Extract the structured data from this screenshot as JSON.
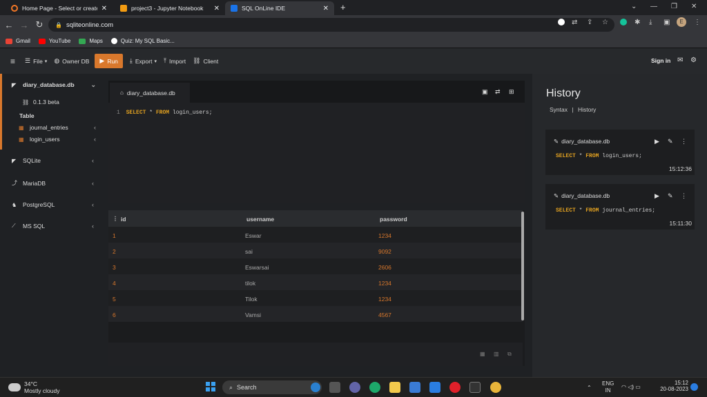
{
  "browser": {
    "tabs": [
      {
        "title": "Home Page - Select or create a n",
        "color": "#f37726"
      },
      {
        "title": "project3 - Jupyter Notebook",
        "color": "#f39c12"
      },
      {
        "title": "SQL OnLine IDE",
        "color": "#1a73e8"
      }
    ],
    "url": "sqliteonline.com",
    "bookmarks": [
      {
        "label": "Gmail",
        "color": "#ea4335"
      },
      {
        "label": "YouTube",
        "color": "#ff0000"
      },
      {
        "label": "Maps",
        "color": "#34a853"
      },
      {
        "label": "Quiz: My SQL Basic...",
        "color": "#ffffff"
      }
    ],
    "profile_initial": "E"
  },
  "toolbar": {
    "file": "File",
    "owner_db": "Owner DB",
    "run": "Run",
    "export": "Export",
    "import": "Import",
    "client": "Client",
    "signin": "Sign in"
  },
  "sidebar": {
    "db_name": "diary_database.db",
    "version": "0.1.3 beta",
    "table_heading": "Table",
    "tables": [
      "journal_entries",
      "login_users"
    ],
    "engines": [
      "SQLite",
      "MariaDB",
      "PostgreSQL",
      "MS SQL"
    ]
  },
  "editor": {
    "tab": "diary_database.db",
    "line_number": "1",
    "kw1": "SELECT",
    "star": "*",
    "kw2": "FROM",
    "table": "login_users;"
  },
  "results": {
    "columns": [
      "id",
      "username",
      "password"
    ],
    "rows": [
      [
        "1",
        "Eswar",
        "1234"
      ],
      [
        "2",
        "sai",
        "9092"
      ],
      [
        "3",
        "Eswarsai",
        "2606"
      ],
      [
        "4",
        "tilok",
        "1234"
      ],
      [
        "5",
        "Tilok",
        "1234"
      ],
      [
        "6",
        "Vamsi",
        "4567"
      ]
    ]
  },
  "history": {
    "title": "History",
    "syntax": "Syntax",
    "sep": "|",
    "history_link": "History",
    "items": [
      {
        "db": "diary_database.db",
        "kw1": "SELECT",
        "star": "*",
        "kw2": "FROM",
        "table": "login_users;",
        "time": "15:12:36"
      },
      {
        "db": "diary_database.db",
        "kw1": "SELECT",
        "star": "*",
        "kw2": "FROM",
        "table": "journal_entries;",
        "time": "15:11:30"
      }
    ]
  },
  "taskbar": {
    "temp": "34°C",
    "weather": "Mostly cloudy",
    "search": "Search",
    "lang1": "ENG",
    "lang2": "IN",
    "time": "15:12",
    "date": "20-08-2023"
  }
}
